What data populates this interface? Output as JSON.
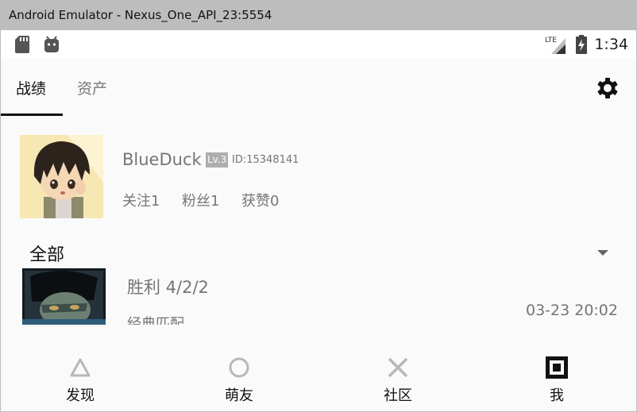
{
  "window": {
    "title": "Android Emulator - Nexus_One_API_23:5554"
  },
  "statusbar": {
    "network": "LTE",
    "time": "1:34"
  },
  "tabs": [
    {
      "label": "战绩",
      "active": true
    },
    {
      "label": "资产",
      "active": false
    }
  ],
  "profile": {
    "name": "BlueDuck",
    "level": "Lv.3",
    "id": "ID:15348141",
    "follow": "关注1",
    "fans": "粉丝1",
    "likes": "获赞0"
  },
  "filter": {
    "selected": "全部"
  },
  "matches": [
    {
      "result": "胜利 4/2/2",
      "mode": "经典匹配",
      "time": "03-23 20:02"
    }
  ],
  "bottom_nav": [
    {
      "label": "发现",
      "icon": "triangle-icon"
    },
    {
      "label": "萌友",
      "icon": "circle-icon"
    },
    {
      "label": "社区",
      "icon": "cross-icon"
    },
    {
      "label": "我",
      "icon": "square-icon",
      "active": true
    }
  ],
  "colors": {
    "active_text": "#111111",
    "muted_text": "#757575",
    "inactive_icon": "#b8b8b8",
    "background": "#fafafa"
  }
}
